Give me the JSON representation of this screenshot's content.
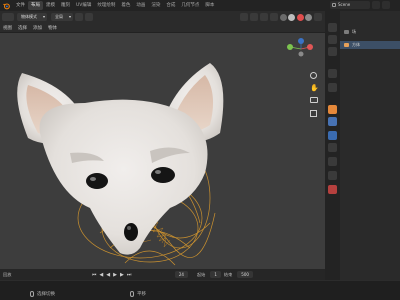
{
  "menu": {
    "file": "文件",
    "tabs": [
      "布局",
      "建模",
      "雕刻",
      "UV编辑",
      "纹理绘制",
      "着色",
      "动画",
      "渲染",
      "合成",
      "几何节点",
      "脚本"
    ],
    "active_tab_index": 0,
    "scene_name": "Scene"
  },
  "viewport_header": {
    "mode": "物体模式",
    "view": "视图",
    "select": "选择",
    "add": "添加",
    "object": "物体",
    "transform": "全局"
  },
  "outliner": {
    "rows": [
      {
        "label": "场",
        "selected": false,
        "icon_color": "#7d7d7d"
      },
      {
        "label": "方体",
        "selected": true,
        "icon_color": "#e6a15a"
      }
    ]
  },
  "timeline": {
    "label": "回放",
    "current_frame": "24",
    "start_label": "起始",
    "start_value": "1",
    "end_label": "结束",
    "end_value": "500"
  },
  "status": {
    "left_hint": "选择切换",
    "mid_hint": "平移"
  },
  "colors": {
    "accent": "#4772b3",
    "rig_orange": "#e0a23a",
    "fox_fur": "#eae6e3",
    "ear_inner": "#e2c9b7"
  }
}
